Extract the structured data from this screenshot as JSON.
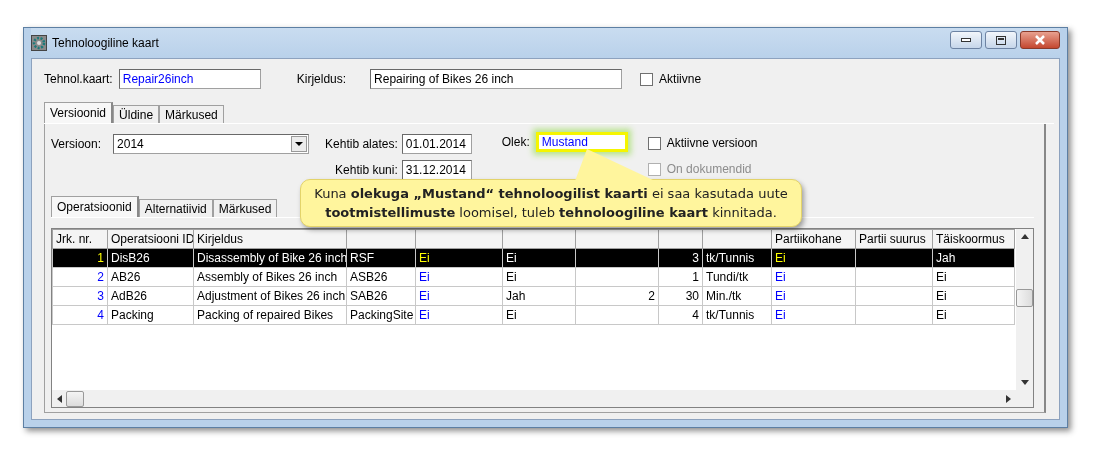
{
  "window": {
    "title": "Tehnoloogiline kaart"
  },
  "header": {
    "card_label": "Tehnol.kaart:",
    "card_value": "Repair26inch",
    "description_label": "Kirjeldus:",
    "description_value": "Repairing of Bikes 26 inch",
    "active": {
      "label": "Aktiivne",
      "checked": false
    }
  },
  "tabs": [
    {
      "label": "Versioonid",
      "selected": true
    },
    {
      "label": "Üldine",
      "selected": false
    },
    {
      "label": "Märkused",
      "selected": false
    }
  ],
  "version": {
    "version_label": "Versioon:",
    "version_value": "2014",
    "valid_from_label": "Kehtib alates:",
    "valid_from": "01.01.2014",
    "valid_to_label": "Kehtib kuni:",
    "valid_to": "31.12.2014",
    "status_label": "Olek:",
    "status_value": "Mustand",
    "status_highlighted": true,
    "checkboxes": [
      {
        "label": "Aktiivne versioon",
        "checked": false,
        "disabled": false
      },
      {
        "label": "On dokumendid",
        "checked": false,
        "disabled": true
      }
    ]
  },
  "sub_tabs": [
    {
      "label": "Operatsioonid",
      "selected": true
    },
    {
      "label": "Alternatiivid",
      "selected": false
    },
    {
      "label": "Märkused",
      "selected": false
    }
  ],
  "table": {
    "columns": [
      {
        "label": "Jrk. nr.",
        "kind": "index"
      },
      {
        "label": "Operatsiooni ID",
        "kind": "text"
      },
      {
        "label": "Kirjeldus",
        "kind": "text"
      },
      {
        "kind": "text"
      },
      {
        "kind": "link"
      },
      {
        "kind": "text"
      },
      {
        "kind": "number"
      },
      {
        "kind": "number"
      },
      {
        "kind": "text"
      },
      {
        "label": "Partiikohane",
        "kind": "link"
      },
      {
        "label": "Partii suurus",
        "kind": "text"
      },
      {
        "label": "Täiskoormus",
        "kind": "text"
      }
    ],
    "rows": [
      {
        "selected": true,
        "cells": [
          "1",
          "DisB26",
          "Disassembly of Bike 26 inch",
          "RSF",
          "Ei",
          "Ei",
          null,
          "3",
          "tk/Tunnis",
          "Ei",
          null,
          "Jah"
        ]
      },
      {
        "selected": false,
        "cells": [
          "2",
          "AB26",
          "Assembly of Bikes 26 inch",
          "ASB26",
          "Ei",
          "Ei",
          null,
          "1",
          "Tundi/tk",
          "Ei",
          null,
          "Ei"
        ]
      },
      {
        "selected": false,
        "cells": [
          "3",
          "AdB26",
          "Adjustment of Bikes 26 inch",
          "SAB26",
          "Ei",
          "Jah",
          "2",
          "30",
          "Min./tk",
          "Ei",
          null,
          "Ei"
        ]
      },
      {
        "selected": false,
        "cells": [
          "4",
          "Packing",
          "Packing of repaired Bikes",
          "PackingSite",
          "Ei",
          "Ei",
          null,
          "4",
          "tk/Tunnis",
          "Ei",
          null,
          "Ei"
        ]
      }
    ]
  },
  "callout": {
    "text": "Kuna **olekuga „Mustand“ tehnoloogilist kaarti** ei saa kasutada uute **tootmistellimuste** loomisel, tuleb **tehnoloogiline kaart** kinnitada."
  }
}
